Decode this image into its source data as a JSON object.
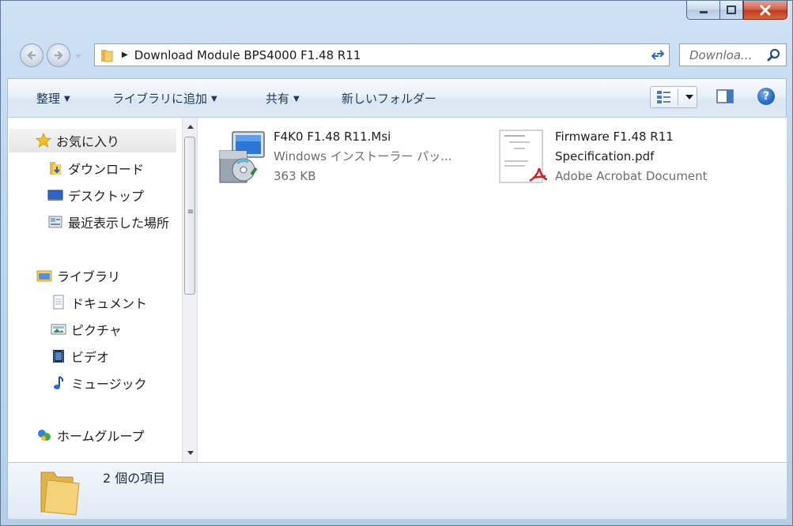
{
  "window": {
    "caption": {
      "minimize_icon": "minimize-icon",
      "maximize_icon": "maximize-icon",
      "close_icon": "close-icon"
    }
  },
  "address": {
    "path": "Download Module BPS4000 F1.48 R11",
    "separator": "▶",
    "search_placeholder": "Downloa..."
  },
  "toolbar": {
    "organize": "整理",
    "add_to_library": "ライブラリに追加",
    "share": "共有",
    "new_folder": "新しいフォルダー"
  },
  "sidebar": {
    "favorites": "お気に入り",
    "downloads": "ダウンロード",
    "desktop": "デスクトップ",
    "recent": "最近表示した場所",
    "libraries": "ライブラリ",
    "documents": "ドキュメント",
    "pictures": "ピクチャ",
    "videos": "ビデオ",
    "music": "ミュージック",
    "homegroup": "ホームグループ"
  },
  "files": [
    {
      "name": "F4K0 F1.48 R11.Msi",
      "type": "Windows インストーラー パッ...",
      "size": "363 KB",
      "icon": "msi-installer-icon"
    },
    {
      "name_line1": "Firmware F1.48 R11",
      "name_line2": "Specification.pdf",
      "type": "Adobe Acrobat Document",
      "icon": "pdf-document-icon"
    }
  ],
  "status": {
    "item_count": "2 個の項目"
  },
  "colors": {
    "frame": "#bdd5ee",
    "close_button": "#c8452a",
    "toolbar_text": "#1e3a5a",
    "secondary_text": "#6d6d6d"
  }
}
